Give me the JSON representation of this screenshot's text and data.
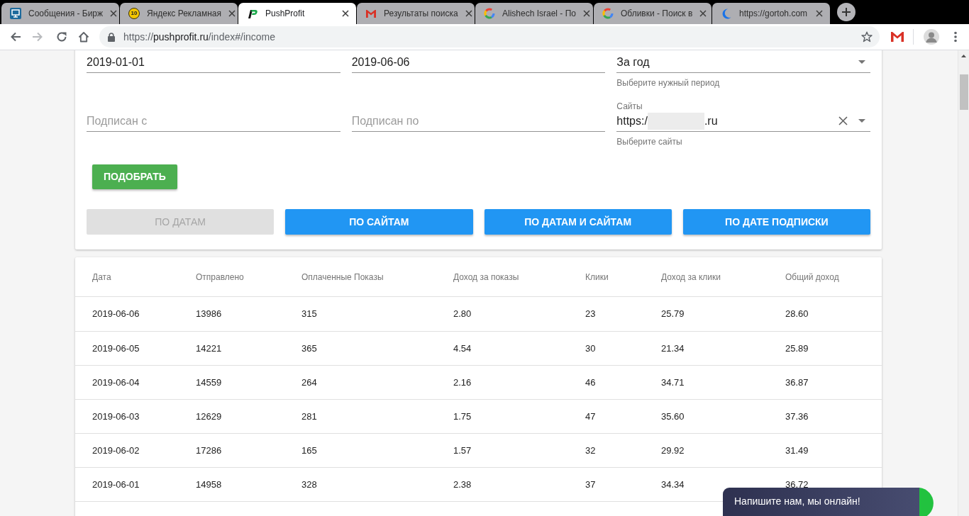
{
  "browser": {
    "tabs": [
      {
        "title": "Сообщения - Бирж",
        "selected": false
      },
      {
        "title": "Яндекс Рекламная",
        "icon_text": "10",
        "selected": false
      },
      {
        "title": "PushProfit",
        "selected": true
      },
      {
        "title": "Результаты поиска",
        "selected": false
      },
      {
        "title": "Alishech Israel - По",
        "selected": false
      },
      {
        "title": "Обливки - Поиск в",
        "selected": false
      },
      {
        "title": "https://gortoh.com",
        "selected": false
      }
    ],
    "navigation": {
      "forward_disabled": true
    },
    "address_bar": {
      "url_start": "https://",
      "url_host": "pushprofit.ru",
      "url_end": "/index#/income"
    }
  },
  "filters": {
    "fields": [
      {
        "kind": "input",
        "value": "2019-01-01"
      },
      {
        "kind": "input",
        "value": "2019-06-06"
      },
      {
        "kind": "select",
        "value": "За год",
        "hint": "Выберите нужный период"
      },
      {
        "kind": "input",
        "placeholder": "Подписан с"
      },
      {
        "kind": "input",
        "placeholder": "Подписан по"
      },
      {
        "kind": "select",
        "label": "Сайты",
        "value": "https:/",
        "value_end": ".ru",
        "redacted": true,
        "clearable": true,
        "hint": "Выберите сайты"
      }
    ],
    "submit_button": "ПОДОБРАТЬ",
    "view_buttons": [
      {
        "label": "ПО ДАТАМ",
        "disabled": true
      },
      {
        "label": "ПО САЙТАМ",
        "disabled": false
      },
      {
        "label": "ПО ДАТАМ И САЙТАМ",
        "disabled": false
      },
      {
        "label": "ПО ДАТЕ ПОДПИСКИ",
        "disabled": false
      }
    ]
  },
  "table": {
    "columns": [
      "Дата",
      "Отправлено",
      "Оплаченные Показы",
      "Доход за показы",
      "Клики",
      "Доход за клики",
      "Общий доход"
    ],
    "rows": [
      [
        "2019-06-06",
        "13986",
        "315",
        "2.80",
        "23",
        "25.79",
        "28.60"
      ],
      [
        "2019-06-05",
        "14221",
        "365",
        "4.54",
        "30",
        "21.34",
        "25.89"
      ],
      [
        "2019-06-04",
        "14559",
        "264",
        "2.16",
        "46",
        "34.71",
        "36.87"
      ],
      [
        "2019-06-03",
        "12629",
        "281",
        "1.75",
        "47",
        "35.60",
        "37.36"
      ],
      [
        "2019-06-02",
        "17286",
        "165",
        "1.57",
        "32",
        "29.92",
        "31.49"
      ],
      [
        "2019-06-01",
        "14958",
        "328",
        "2.38",
        "37",
        "34.34",
        "36.72"
      ]
    ]
  },
  "chat_widget": {
    "text": "Напишите нам, мы онлайн!"
  }
}
